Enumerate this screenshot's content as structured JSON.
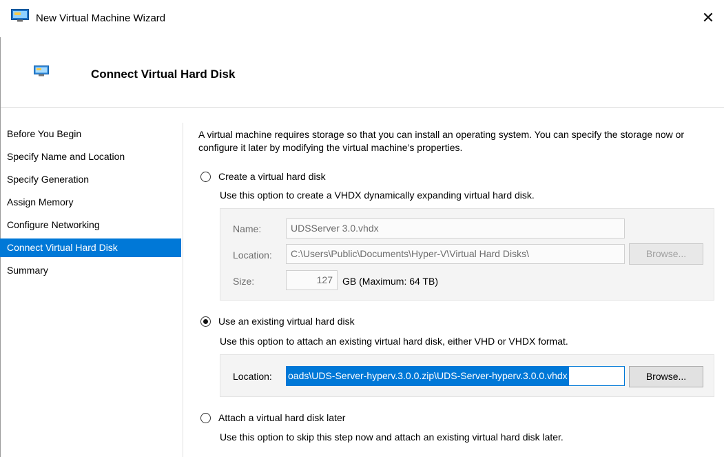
{
  "window": {
    "title": "New Virtual Machine Wizard",
    "close_glyph": "✕"
  },
  "header": {
    "title": "Connect Virtual Hard Disk"
  },
  "nav": {
    "items": [
      {
        "label": "Before You Begin"
      },
      {
        "label": "Specify Name and Location"
      },
      {
        "label": "Specify Generation"
      },
      {
        "label": "Assign Memory"
      },
      {
        "label": "Configure Networking"
      },
      {
        "label": "Connect Virtual Hard Disk",
        "active": true
      },
      {
        "label": "Summary"
      }
    ]
  },
  "content": {
    "intro": "A virtual machine requires storage so that you can install an operating system. You can specify the storage now or configure it later by modifying the virtual machine’s properties.",
    "option_create": {
      "label": "Create a virtual hard disk",
      "description": "Use this option to create a VHDX dynamically expanding virtual hard disk.",
      "name_label": "Name:",
      "name_value": "UDSServer 3.0.vhdx",
      "location_label": "Location:",
      "location_value": "C:\\Users\\Public\\Documents\\Hyper-V\\Virtual Hard Disks\\",
      "browse_label": "Browse...",
      "size_label": "Size:",
      "size_value": "127",
      "size_unit": "GB (Maximum: 64 TB)"
    },
    "option_existing": {
      "label": "Use an existing virtual hard disk",
      "description": "Use this option to attach an existing virtual hard disk, either VHD or VHDX format.",
      "location_label": "Location:",
      "location_value": "oads\\UDS-Server-hyperv.3.0.0.zip\\UDS-Server-hyperv.3.0.0.vhdx",
      "browse_label": "Browse..."
    },
    "option_later": {
      "label": "Attach a virtual hard disk later",
      "description": "Use this option to skip this step now and attach an existing virtual hard disk later."
    },
    "selected_option": "option_existing"
  },
  "colors": {
    "accent": "#0078d7"
  }
}
